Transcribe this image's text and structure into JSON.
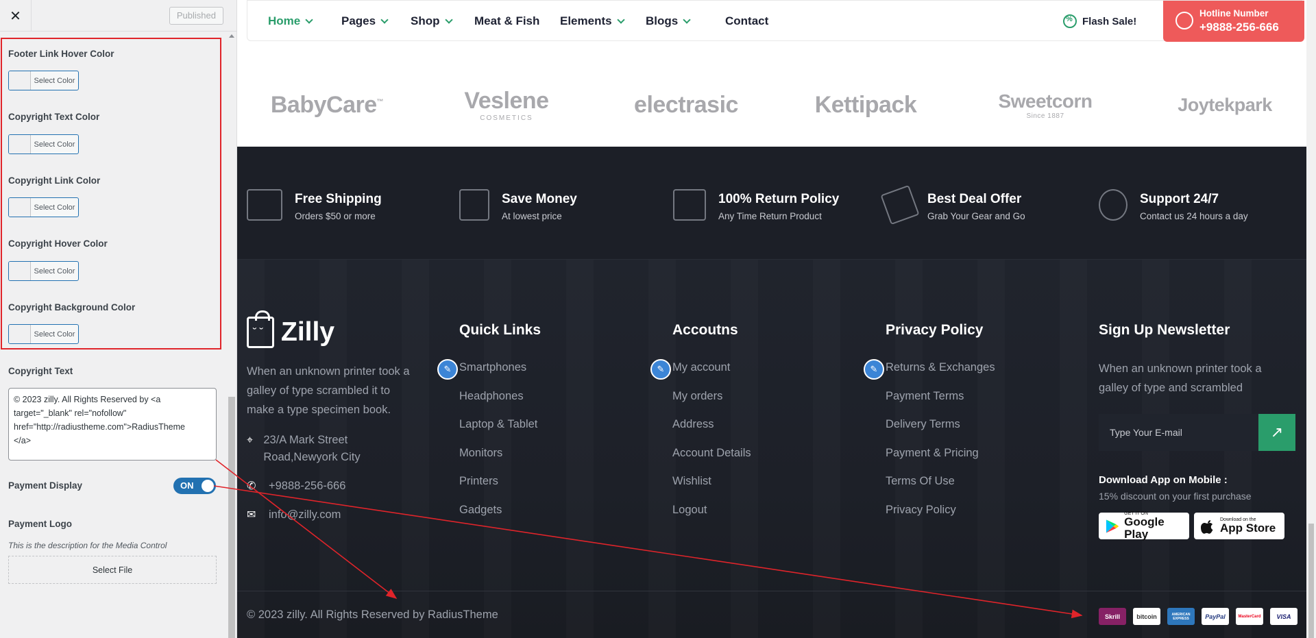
{
  "panel": {
    "close_glyph": "✕",
    "published_label": "Published",
    "color_controls": [
      {
        "label": "Footer Link Hover Color",
        "button": "Select Color"
      },
      {
        "label": "Copyright Text Color",
        "button": "Select Color"
      },
      {
        "label": "Copyright Link Color",
        "button": "Select Color"
      },
      {
        "label": "Copyright Hover Color",
        "button": "Select Color"
      },
      {
        "label": "Copyright Background Color",
        "button": "Select Color"
      }
    ],
    "copyright_text_label": "Copyright Text",
    "copyright_text_value": "© 2023 zilly. All Rights Reserved by <a\ntarget=\"_blank\" rel=\"nofollow\"\nhref=\"http://radiustheme.com\">RadiusTheme\n</a>",
    "payment_display_label": "Payment Display",
    "payment_toggle_text": "ON",
    "payment_logo_label": "Payment Logo",
    "media_description": "This is the description for the Media Control",
    "select_file_label": "Select File",
    "highlight_color": "#e0242a",
    "accent_color": "#2271b1"
  },
  "nav": {
    "items": [
      {
        "label": "Home",
        "has_dropdown": true,
        "active": true
      },
      {
        "label": "Pages",
        "has_dropdown": true
      },
      {
        "label": "Shop",
        "has_dropdown": true
      },
      {
        "label": "Meat & Fish",
        "has_dropdown": false
      },
      {
        "label": "Elements",
        "has_dropdown": true
      },
      {
        "label": "Blogs",
        "has_dropdown": true
      },
      {
        "label": "Contact",
        "has_dropdown": false
      }
    ],
    "flash_sale": "Flash Sale!",
    "hotline_label": "Hotline Number",
    "hotline_number": "+9888-256-666",
    "hotline_color": "#ee5a5a",
    "brand_green": "#2a9d6b"
  },
  "brands": [
    {
      "name": "BabyCare",
      "tag": "™"
    },
    {
      "name": "Veslene",
      "tag": "COSMETICS"
    },
    {
      "name": "electrasic",
      "tag": ""
    },
    {
      "name": "Kettipack",
      "tag": ""
    },
    {
      "name": "Sweetcorn",
      "tag": "Since 1887"
    },
    {
      "name": "Joytekpark",
      "tag": ""
    }
  ],
  "services": [
    {
      "title": "Free Shipping",
      "subtitle": "Orders $50 or more",
      "icon": "truck-icon"
    },
    {
      "title": "Save Money",
      "subtitle": "At lowest price",
      "icon": "money-hand-icon"
    },
    {
      "title": "100% Return Policy",
      "subtitle": "Any Time Return Product",
      "icon": "return-box-icon"
    },
    {
      "title": "Best Deal Offer",
      "subtitle": "Grab Your Gear and Go",
      "icon": "deal-tag-icon"
    },
    {
      "title": "Support 24/7",
      "subtitle": "Contact us 24 hours a day",
      "icon": "percent-badge-icon"
    }
  ],
  "footer": {
    "logo_name": "Zilly",
    "about": "When an unknown printer took a galley of type scrambled it to make a type specimen book.",
    "address": "23/A Mark Street Road,Newyork City",
    "phone": "+9888-256-666",
    "email": "info@zilly.com",
    "columns": [
      {
        "title": "Quick Links",
        "links": [
          "Smartphones",
          "Headphones",
          "Laptop & Tablet",
          "Monitors",
          "Printers",
          "Gadgets"
        ]
      },
      {
        "title": "Accoutns",
        "links": [
          "My account",
          "My orders",
          "Address",
          "Account Details",
          "Wishlist",
          "Logout"
        ]
      },
      {
        "title": "Privacy Policy",
        "links": [
          "Returns & Exchanges",
          "Payment Terms",
          "Delivery Terms",
          "Payment & Pricing",
          "Terms Of Use",
          "Privacy Policy"
        ]
      }
    ],
    "newsletter_title": "Sign Up Newsletter",
    "newsletter_text": "When an unknown printer took a galley of type and scrambled",
    "email_placeholder": "Type Your E-mail",
    "subscribe_glyph": "↗",
    "app_title": "Download App on Mobile :",
    "app_subtitle": "15% discount on your first purchase",
    "google_play_small": "GET IT ON",
    "google_play_big": "Google Play",
    "app_store_small": "Download on the",
    "app_store_big": "App Store",
    "copyright": "© 2023 zilly. All Rights Reserved by RadiusTheme",
    "payments": [
      {
        "name": "Skrill",
        "bg": "#862165",
        "fg": "#ffffff"
      },
      {
        "name": "bitcoin",
        "bg": "#ffffff",
        "fg": "#333333"
      },
      {
        "name": "AMERICAN EXPRESS",
        "bg": "#2e77bc",
        "fg": "#ffffff"
      },
      {
        "name": "PayPal",
        "bg": "#ffffff",
        "fg": "#253b80"
      },
      {
        "name": "MasterCard",
        "bg": "#ffffff",
        "fg": "#eb001b"
      },
      {
        "name": "VISA",
        "bg": "#ffffff",
        "fg": "#1a1f71"
      }
    ],
    "edit_glyph": "✎"
  }
}
